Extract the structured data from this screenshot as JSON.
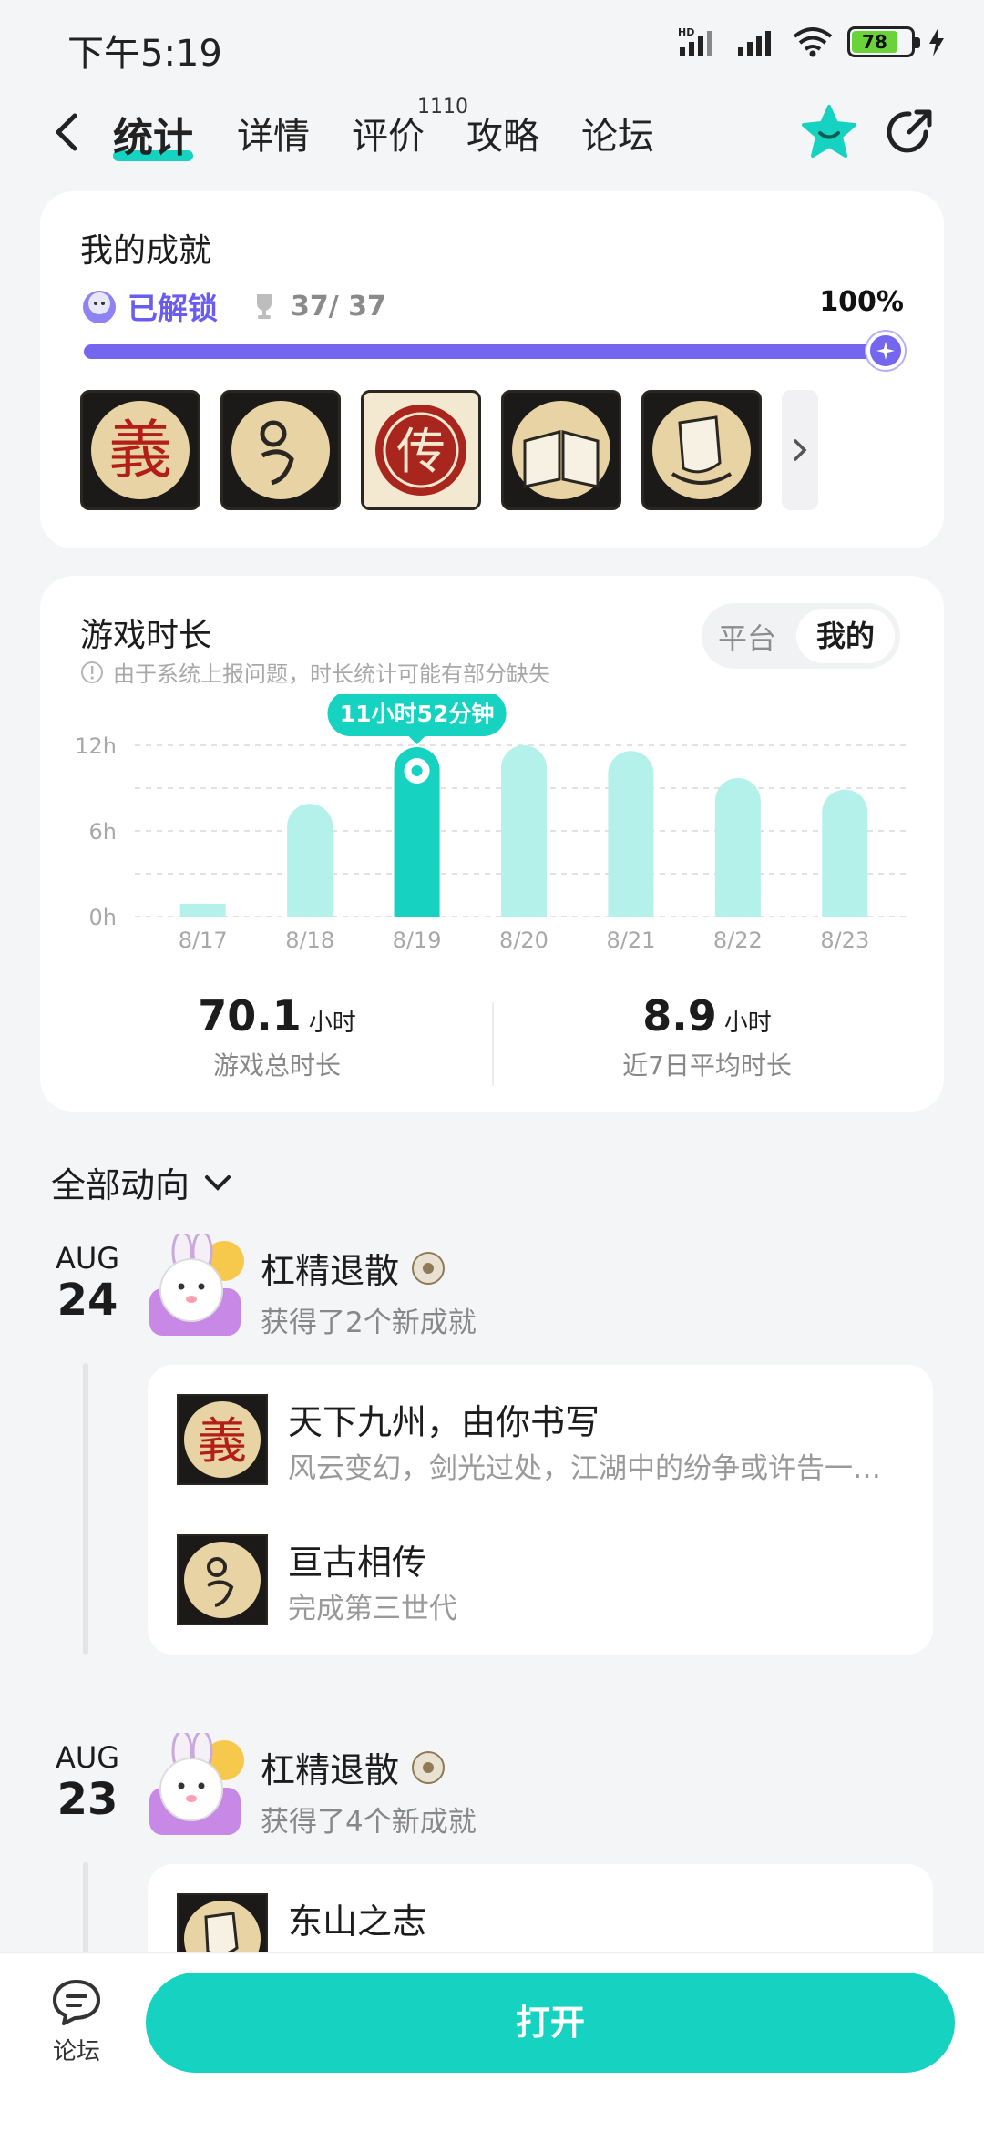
{
  "status_bar": {
    "time": "下午5:19",
    "battery": "78",
    "network_label": "HD"
  },
  "nav": {
    "tabs": [
      {
        "label": "统计"
      },
      {
        "label": "详情"
      },
      {
        "label": "评价"
      },
      {
        "label": "攻略"
      },
      {
        "label": "论坛"
      }
    ],
    "review_count": "1110"
  },
  "achievements": {
    "title": "我的成就",
    "unlocked_label": "已解锁",
    "trophy_count": "37/ 37",
    "percent_label": "100%",
    "progress": 1.0,
    "badges": [
      "义-badge",
      "spiral-badge",
      "传-badge",
      "book-badge",
      "scroll-badge"
    ]
  },
  "playtime": {
    "title": "游戏时长",
    "tip": "由于系统上报问题，时长统计可能有部分缺失",
    "toggle_platform": "平台",
    "toggle_mine": "我的",
    "tooltip": "11小时52分钟",
    "total_value": "70.1",
    "total_unit": "小时",
    "total_label": "游戏总时长",
    "avg_value": "8.9",
    "avg_unit": "小时",
    "avg_label": "近7日平均时长"
  },
  "chart_data": {
    "type": "bar",
    "categories": [
      "8/17",
      "8/18",
      "8/19",
      "8/20",
      "8/21",
      "8/22",
      "8/23"
    ],
    "values": [
      0.9,
      7.9,
      11.87,
      12.0,
      11.6,
      9.7,
      8.9
    ],
    "y_tick_labels": [
      "0h",
      "6h",
      "12h"
    ],
    "y_ticks": [
      0,
      6,
      12
    ],
    "ylim": [
      0,
      12
    ],
    "highlight_index": 2,
    "grid": true,
    "colors": {
      "bar": "#b3f1ea",
      "highlight": "#16d2c0"
    }
  },
  "feed": {
    "filter_label": "全部动向",
    "groups": [
      {
        "month": "AUG",
        "day": "24",
        "user": "杠精退散",
        "desc": "获得了2个新成就",
        "entries": [
          {
            "title": "天下九州，由你书写",
            "sub": "风云变幻，剑光过处，江湖中的纷争或许告一段落"
          },
          {
            "title": "亘古相传",
            "sub": "完成第三世代"
          }
        ]
      },
      {
        "month": "AUG",
        "day": "23",
        "user": "杠精退散",
        "desc": "获得了4个新成就",
        "entries": [
          {
            "title": "东山之志",
            "sub": ""
          }
        ]
      }
    ]
  },
  "bottom": {
    "forum_label": "论坛",
    "open_label": "打开"
  }
}
